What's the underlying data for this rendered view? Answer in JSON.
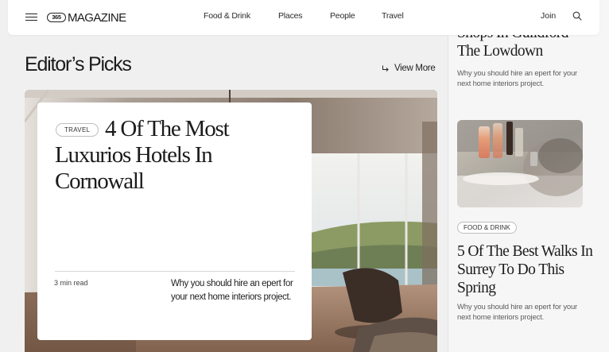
{
  "header": {
    "logo_badge": "365",
    "logo_word": "MAGAZINE",
    "nav": [
      "Food & Drink",
      "Places",
      "People",
      "Travel"
    ],
    "join_label": "Join",
    "icons": [
      "menu-icon",
      "search-icon"
    ]
  },
  "section": {
    "title": "Editor’s Picks",
    "view_more": "View More"
  },
  "hero": {
    "tag": "TRAVEL",
    "title": "4 Of The Most Luxurios Hotels In Cornowall",
    "read_time": "3 min read",
    "description": "Why you should hire an epert for your next home interiors project."
  },
  "sidebar": {
    "prev_title": "Shops In Guildford – The Lowdown",
    "prev_description": "Why you should hire an epert for your next home interiors project.",
    "card_tag": "FOOD & DRINK",
    "card_title": "5 Of The Best Walks In Surrey To Do This Spring",
    "card_description": "Why you should hire an epert for your next home interiors project."
  },
  "colors": {
    "page_bg": "#f0f0f0",
    "header_bg": "#ffffff",
    "text": "#1b1b1b",
    "muted": "#5d5d5d"
  }
}
